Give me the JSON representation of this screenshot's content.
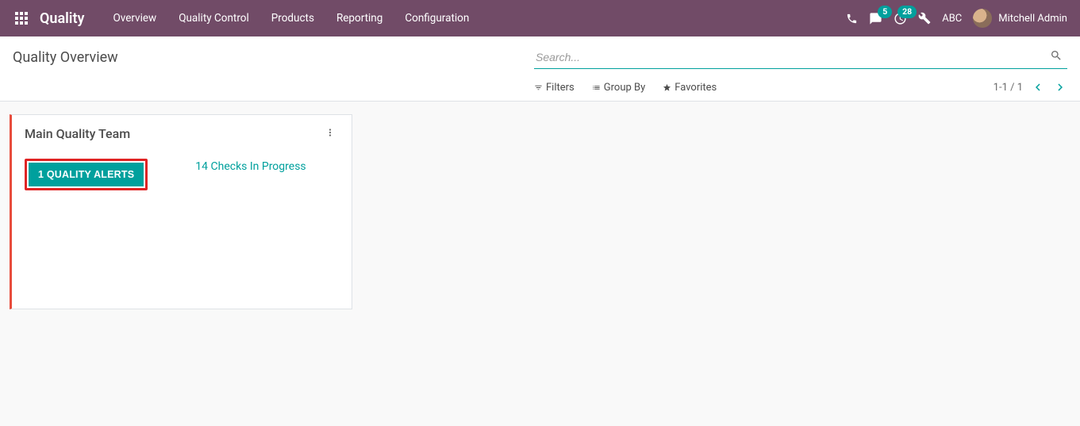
{
  "navbar": {
    "brand": "Quality",
    "menu": [
      "Overview",
      "Quality Control",
      "Products",
      "Reporting",
      "Configuration"
    ],
    "messages_badge": "5",
    "activities_badge": "28",
    "company": "ABC",
    "user_name": "Mitchell Admin"
  },
  "control_panel": {
    "title": "Quality Overview",
    "search_placeholder": "Search...",
    "filters_label": "Filters",
    "groupby_label": "Group By",
    "favorites_label": "Favorites",
    "pager": "1-1 / 1"
  },
  "card": {
    "title": "Main Quality Team",
    "alert_button": "1 QUALITY ALERTS",
    "checks_link": "14 Checks In Progress"
  }
}
